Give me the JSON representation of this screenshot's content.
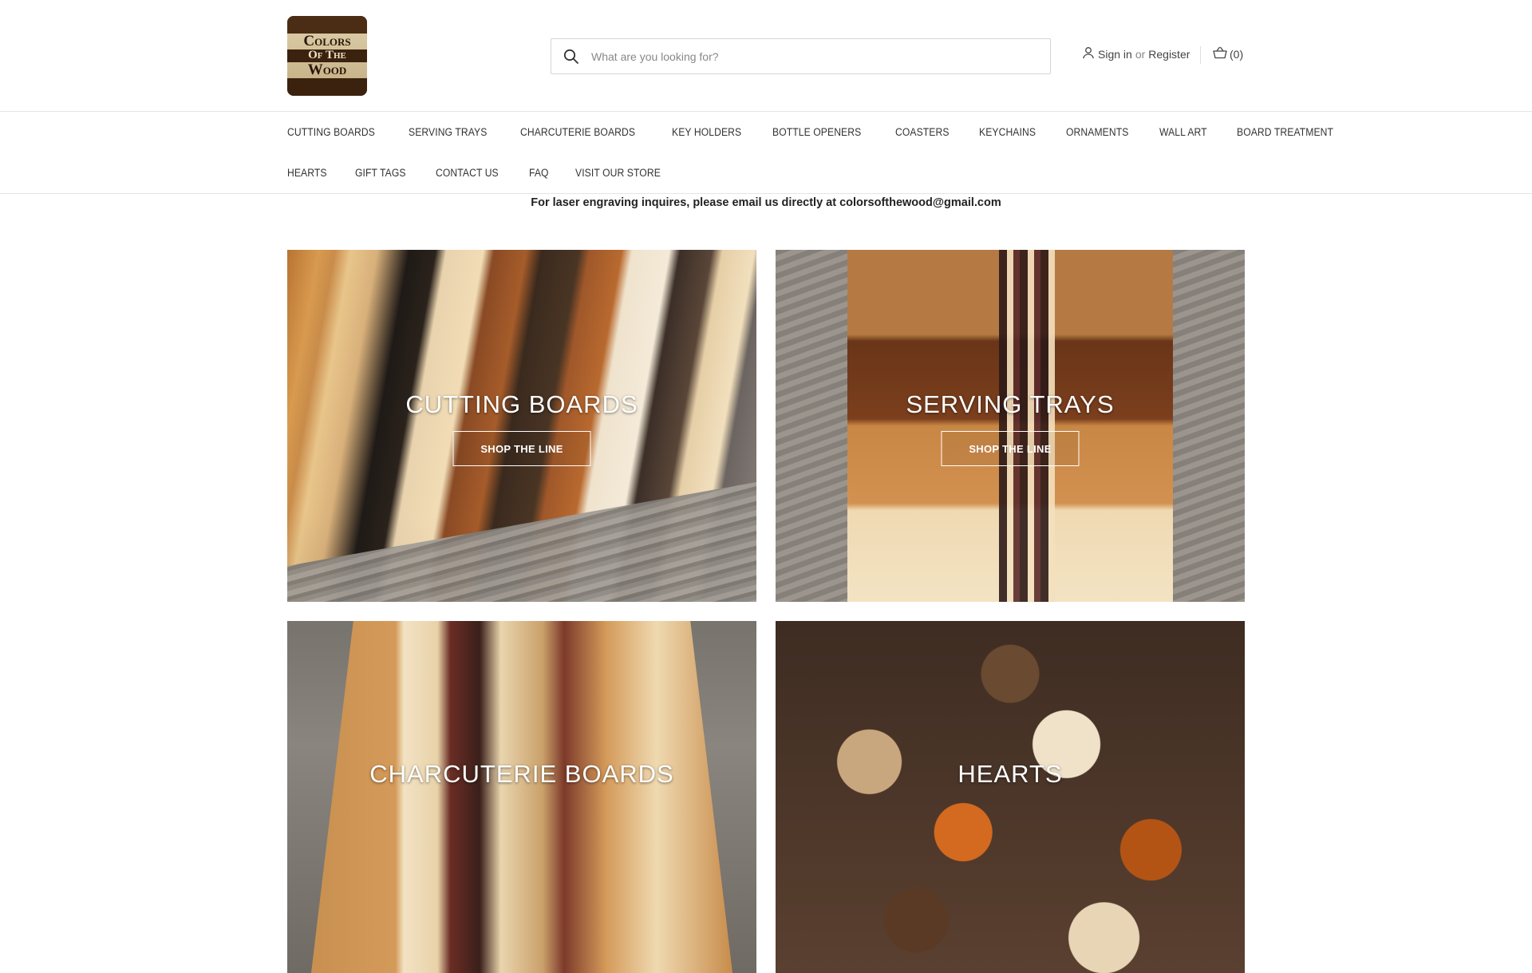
{
  "header": {
    "logo_lines": [
      "Colors",
      "Of The",
      "Wood"
    ],
    "search_placeholder": "What are you looking for?",
    "account": {
      "sign_in": "Sign in",
      "or": "or",
      "register": "Register"
    },
    "cart_count": "(0)"
  },
  "nav": {
    "row1": [
      "Cutting Boards",
      "Serving Trays",
      "Charcuterie Boards",
      "Key Holders",
      "Bottle Openers",
      "Coasters",
      "Keychains",
      "Ornaments",
      "Wall Art",
      "Board Treatment"
    ],
    "row2": [
      "Hearts",
      "Gift Tags",
      "Contact Us",
      "FAQ",
      "Visit Our Store"
    ]
  },
  "notice": "For laser engraving inquires, please email us directly at colorsofthewood@gmail.com",
  "tiles": [
    {
      "title": "Cutting Boards",
      "button": "Shop The Line"
    },
    {
      "title": "Serving Trays",
      "button": "Shop The Line"
    },
    {
      "title": "Charcuterie Boards"
    },
    {
      "title": "Hearts"
    }
  ]
}
